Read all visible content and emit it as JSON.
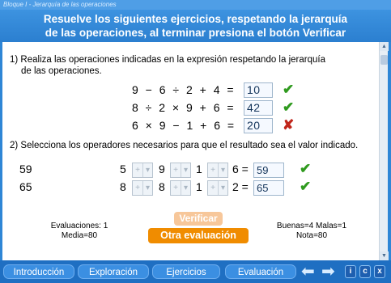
{
  "breadcrumb": "Bloque I - Jerarquía de las operaciones",
  "header": {
    "line1": "Resuelve los siguientes ejercicios, respetando la jerarquía",
    "line2": "de las operaciones, al terminar presiona el botón Verificar"
  },
  "q1": {
    "line1": "1) Realiza las operaciones indicadas en la expresión respetando la jerarquía",
    "line2": "de las operaciones.",
    "rows": [
      {
        "expr": "9 − 6 ÷ 2 + 4 =",
        "answer": "10",
        "result": "correct"
      },
      {
        "expr": "8 ÷ 2 × 9 + 6 =",
        "answer": "42",
        "result": "correct"
      },
      {
        "expr": "6 × 9 − 1 + 6 =",
        "answer": "20",
        "result": "incorrect"
      }
    ]
  },
  "q2": {
    "label": "2) Selecciona los operadores necesarios para que el resultado sea el valor indicado.",
    "rows": [
      {
        "target": "59",
        "n1": "5",
        "n2": "9",
        "n3": "1",
        "eq": "6 =",
        "answer": "59",
        "result": "correct"
      },
      {
        "target": "65",
        "n1": "8",
        "n2": "8",
        "n3": "1",
        "eq": "2 =",
        "answer": "65",
        "result": "correct"
      }
    ],
    "selector_glyphs": {
      "left": "+",
      "right": "▾"
    }
  },
  "stats": {
    "left_line1": "Evaluaciones: 1",
    "left_line2": "Media=80",
    "right_line1": "Buenas=4  Malas=1",
    "right_line2": "Nota=80"
  },
  "buttons": {
    "verify": "Verificar",
    "other": "Otra evaluación"
  },
  "marks": {
    "check": "✔",
    "cross": "✘"
  },
  "nav": {
    "tabs": [
      "Introducción",
      "Exploración",
      "Ejercicios",
      "Evaluación"
    ],
    "prev": "⬅",
    "next": "➡",
    "info": "i",
    "c": "c",
    "x": "x"
  },
  "scrollbar": {
    "up": "▲",
    "down": "▼"
  }
}
